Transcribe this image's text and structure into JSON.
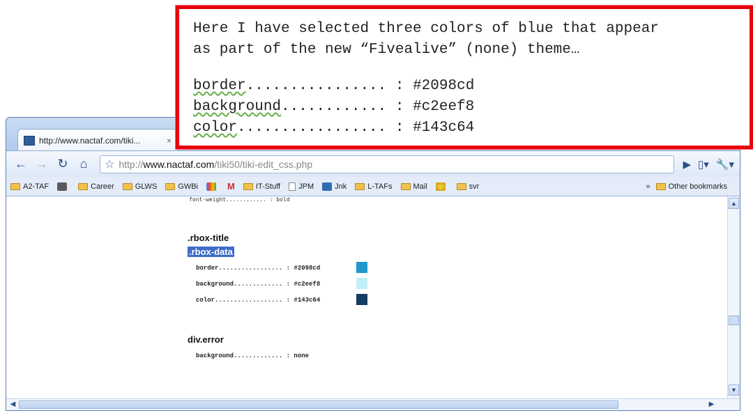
{
  "callout": {
    "line1": "Here I have selected three colors of blue that appear",
    "line2": "as part of the new “Fivealive” (none) theme…",
    "rows": [
      {
        "key": "border",
        "dots": "................ : ",
        "value": "#2098cd"
      },
      {
        "key": "background",
        "dots": "............ : ",
        "value": "#c2eef8"
      },
      {
        "key": "color",
        "dots": "................. : ",
        "value": "#143c64"
      }
    ]
  },
  "browser": {
    "tab_title": "http://www.nactaf.com/tiki...",
    "tab_close": "×",
    "url_prefix": "http://",
    "url_host": "www.nactaf.com",
    "url_path": "/tiki50/tiki-edit_css.php",
    "bookmarks": [
      {
        "label": "A2-TAF",
        "icon": "folder"
      },
      {
        "label": "",
        "icon": "app-logo"
      },
      {
        "label": "Career",
        "icon": "folder"
      },
      {
        "label": "GLWS",
        "icon": "folder"
      },
      {
        "label": "GWBi",
        "icon": "folder"
      },
      {
        "label": "",
        "icon": "google-icon"
      },
      {
        "label": "",
        "icon": "gmail-icon"
      },
      {
        "label": "IT-Stuff",
        "icon": "folder"
      },
      {
        "label": "JPM",
        "icon": "page"
      },
      {
        "label": "Jnk",
        "icon": "s-icon"
      },
      {
        "label": "L-TAFs",
        "icon": "folder"
      },
      {
        "label": "Mail",
        "icon": "folder"
      },
      {
        "label": "",
        "icon": "globe-icon"
      },
      {
        "label": "svr",
        "icon": "folder"
      }
    ],
    "bookmarks_more": "»",
    "other_bookmarks": "Other bookmarks"
  },
  "page": {
    "cut_line": "font-weight............ : bold",
    "sections": [
      {
        "title": ".rbox-title"
      },
      {
        "title": ".rbox-data"
      },
      {
        "title": "div.error"
      }
    ],
    "rbox_props": [
      {
        "text": "border................. : #2098cd",
        "swatch": "#2098cd"
      },
      {
        "text": "background............. : #c2eef8",
        "swatch": "#c2eef8"
      },
      {
        "text": "color.................. : #143c64",
        "swatch": "#143c64"
      }
    ],
    "error_prop": "background............. : none"
  },
  "colors": {
    "callout_border": "#e8000a",
    "selection": "#3f6cc8"
  }
}
